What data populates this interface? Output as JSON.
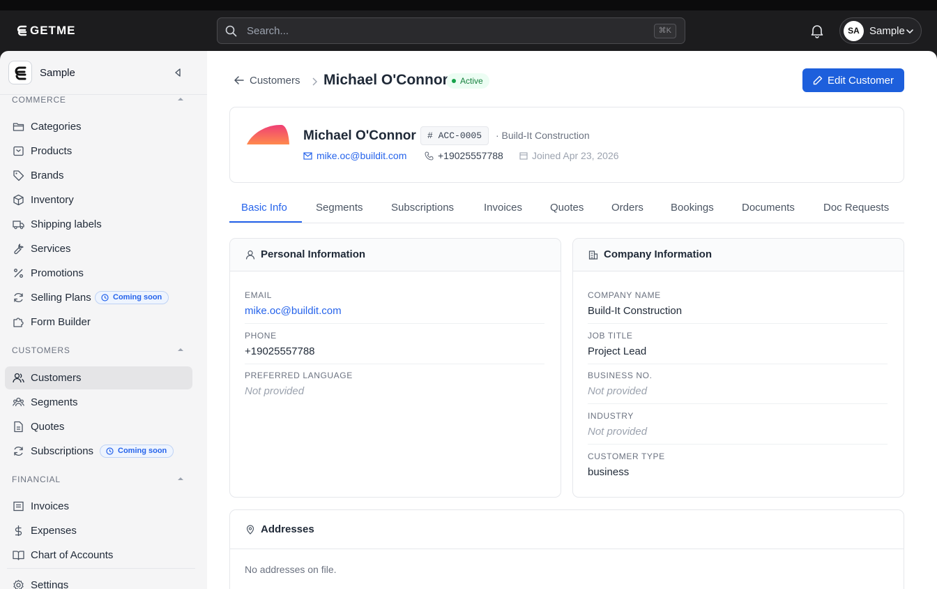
{
  "app": {
    "logo_text": "GETME"
  },
  "search": {
    "placeholder": "Search...",
    "shortcut": "⌘K"
  },
  "user": {
    "initials": "SA",
    "name": "Sample"
  },
  "workspace": {
    "name": "Sample"
  },
  "sidebar": {
    "sections": [
      {
        "title": "COMMERCE",
        "items": [
          {
            "label": "Categories",
            "icon": "folder-icon"
          },
          {
            "label": "Products",
            "icon": "box-icon"
          },
          {
            "label": "Brands",
            "icon": "tag-icon"
          },
          {
            "label": "Inventory",
            "icon": "package-icon"
          },
          {
            "label": "Shipping labels",
            "icon": "truck-icon"
          },
          {
            "label": "Services",
            "icon": "wrench-icon"
          },
          {
            "label": "Promotions",
            "icon": "percent-icon"
          },
          {
            "label": "Selling Plans",
            "icon": "refresh-icon",
            "badge": "Coming soon"
          },
          {
            "label": "Form Builder",
            "icon": "puzzle-icon"
          }
        ]
      },
      {
        "title": "CUSTOMERS",
        "items": [
          {
            "label": "Customers",
            "icon": "users-icon",
            "active": true
          },
          {
            "label": "Segments",
            "icon": "group-icon"
          },
          {
            "label": "Quotes",
            "icon": "file-icon"
          },
          {
            "label": "Subscriptions",
            "icon": "refresh-icon",
            "badge": "Coming soon"
          }
        ]
      },
      {
        "title": "FINANCIAL",
        "items": [
          {
            "label": "Invoices",
            "icon": "receipt-icon"
          },
          {
            "label": "Expenses",
            "icon": "dollar-icon"
          },
          {
            "label": "Chart of Accounts",
            "icon": "book-icon"
          }
        ]
      }
    ],
    "settings_label": "Settings"
  },
  "breadcrumb": {
    "parent": "Customers",
    "current": "Michael O'Connor"
  },
  "status": "Active",
  "edit_button": "Edit Customer",
  "profile": {
    "name": "Michael O'Connor",
    "account_id": "ACC-0005",
    "company": "· Build-It Construction",
    "email": "mike.oc@buildit.com",
    "phone": "+19025557788",
    "joined": "Joined Apr 23, 2026"
  },
  "tabs": [
    "Basic Info",
    "Segments",
    "Subscriptions",
    "Invoices",
    "Quotes",
    "Orders",
    "Bookings",
    "Documents",
    "Doc Requests"
  ],
  "active_tab": "Basic Info",
  "personal": {
    "title": "Personal Information",
    "fields": [
      {
        "label": "EMAIL",
        "value": "mike.oc@buildit.com",
        "style": "link"
      },
      {
        "label": "PHONE",
        "value": "+19025557788",
        "style": "normal"
      },
      {
        "label": "PREFERRED LANGUAGE",
        "value": "Not provided",
        "style": "muted"
      }
    ]
  },
  "company": {
    "title": "Company Information",
    "fields": [
      {
        "label": "COMPANY NAME",
        "value": "Build-It Construction",
        "style": "normal"
      },
      {
        "label": "JOB TITLE",
        "value": "Project Lead",
        "style": "normal"
      },
      {
        "label": "BUSINESS NO.",
        "value": "Not provided",
        "style": "muted"
      },
      {
        "label": "INDUSTRY",
        "value": "Not provided",
        "style": "muted"
      },
      {
        "label": "CUSTOMER TYPE",
        "value": "business",
        "style": "normal"
      }
    ]
  },
  "addresses": {
    "title": "Addresses",
    "empty": "No addresses on file."
  },
  "colors": {
    "accent": "#1d5fdc",
    "topbar": "#1c1c1e",
    "sidebar": "#f5f5f6",
    "active_green": "#16a34a"
  }
}
